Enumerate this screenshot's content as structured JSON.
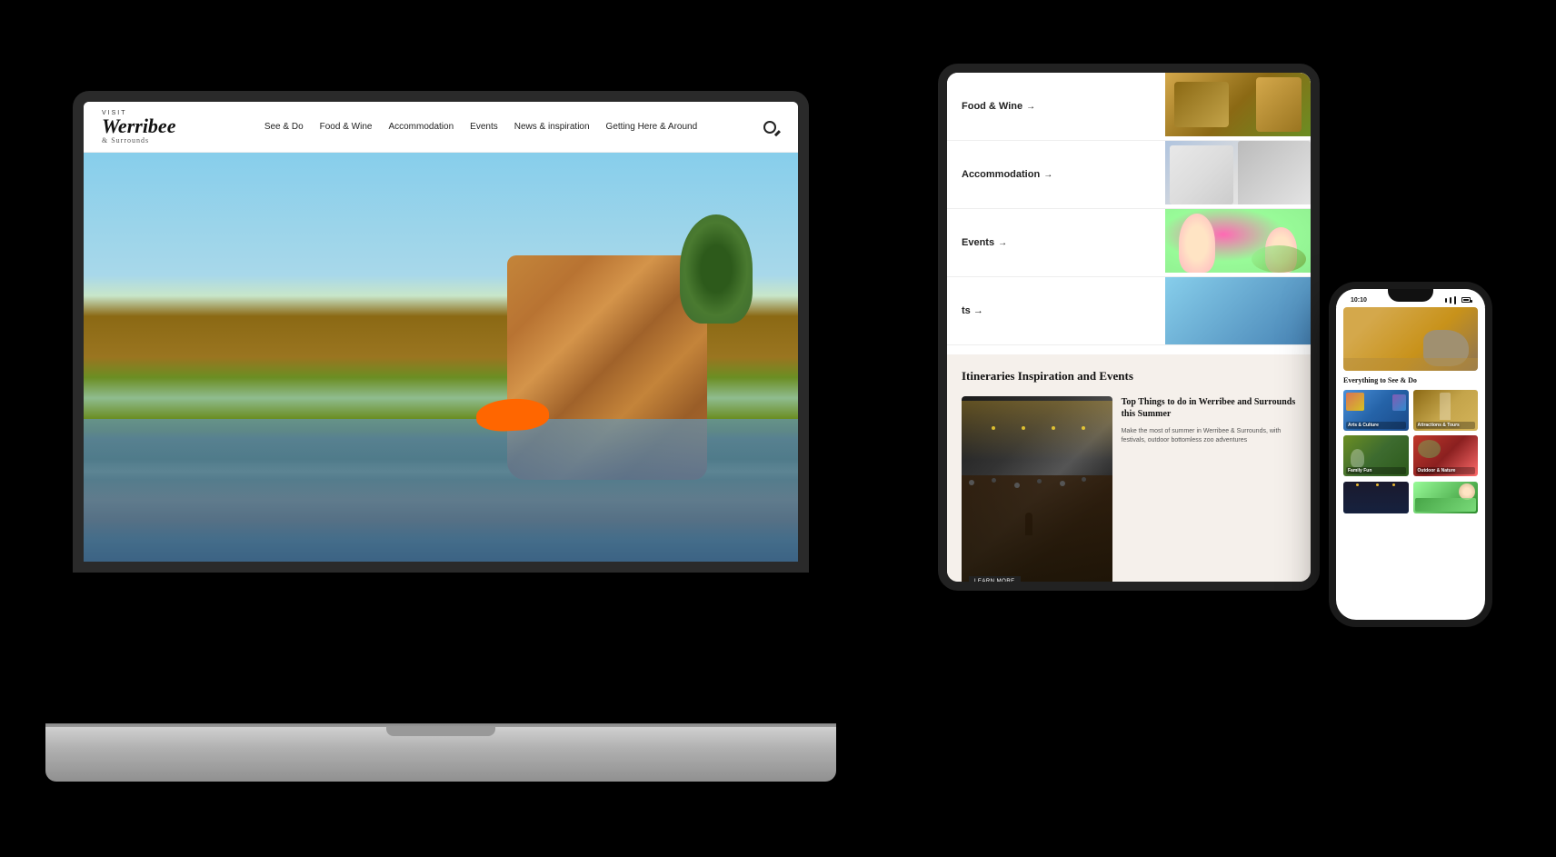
{
  "scene": {
    "background": "#000000"
  },
  "laptop": {
    "navbar": {
      "logo": {
        "visit": "VISIT",
        "name": "Werribee",
        "surrounds": "& Surrounds"
      },
      "links": [
        {
          "label": "See & Do"
        },
        {
          "label": "Food & Wine"
        },
        {
          "label": "Accommodation"
        },
        {
          "label": "Events"
        },
        {
          "label": "News & inspiration"
        },
        {
          "label": "Getting Here & Around"
        }
      ]
    },
    "hero": {
      "alt": "Two kayakers paddling orange kayaks on a river with red cliff faces and eucalyptus trees in the background under a blue sky"
    }
  },
  "tablet": {
    "nav_items": [
      {
        "label": "Food & Wine",
        "arrow": "→"
      },
      {
        "label": "Accommodation",
        "arrow": "→"
      },
      {
        "label": "Events",
        "arrow": "→"
      },
      {
        "label": "",
        "arrow": ""
      }
    ],
    "section_title": "Itineraries Inspiration and Events",
    "article": {
      "title": "Top Things to do in Werribee and Surrounds this Summer",
      "body": "Make the most of summer in Werribee & Surrounds, with festivals, outdoor bottomless zoo adventures",
      "cta": "LEARN MORE"
    }
  },
  "phone": {
    "status_bar": {
      "time": "10:10",
      "signal": "●●●",
      "wifi": "▲",
      "battery": "▮"
    },
    "hero_title": "Everything to See & Do",
    "grid_items": [
      {
        "label": "Arts & Culture"
      },
      {
        "label": "Attractions & Tours"
      },
      {
        "label": "Family Fun"
      },
      {
        "label": "Outdoor & Nature"
      }
    ],
    "grid_row2": [
      {
        "label": ""
      },
      {
        "label": ""
      }
    ]
  }
}
